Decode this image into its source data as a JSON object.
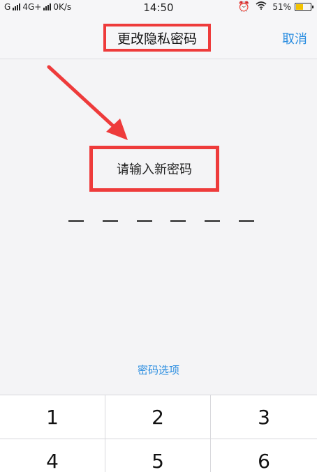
{
  "status_bar": {
    "carrier1": "G",
    "carrier2": "4G+",
    "speed": "0K/s",
    "time": "14:50",
    "alarm_icon": "alarm-clock-icon",
    "wifi_icon": "wifi-icon",
    "battery": "51%",
    "battery_level": 0.51,
    "battery_color": "#f3c300"
  },
  "nav": {
    "title": "更改隐私密码",
    "cancel_label": "取消"
  },
  "prompt": {
    "text": "请输入新密码"
  },
  "pin": {
    "length": 6,
    "entered": 0
  },
  "options": {
    "label": "密码选项"
  },
  "keypad": {
    "keys": [
      "1",
      "2",
      "3",
      "4",
      "5",
      "6"
    ]
  },
  "colors": {
    "accent": "#2a8de0",
    "annotation": "#ee3b3b"
  }
}
